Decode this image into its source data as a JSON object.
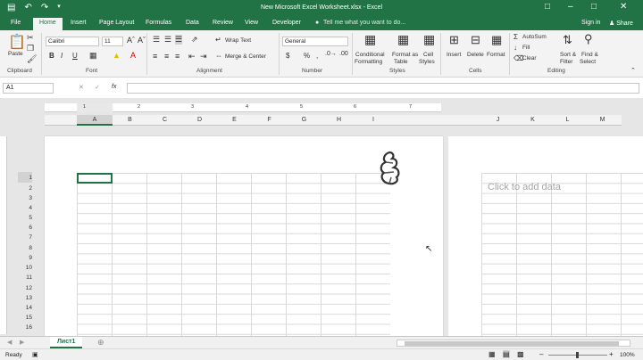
{
  "title_bar": {
    "title": "New Microsoft Excel Worksheet.xlsx - Excel"
  },
  "tabs": [
    {
      "label": "File"
    },
    {
      "label": "Home"
    },
    {
      "label": "Insert"
    },
    {
      "label": "Page Layout"
    },
    {
      "label": "Formulas"
    },
    {
      "label": "Data"
    },
    {
      "label": "Review"
    },
    {
      "label": "View"
    },
    {
      "label": "Developer"
    }
  ],
  "tell_me": "Tell me what you want to do...",
  "sign_in": "Sign in",
  "share": "Share",
  "ribbon": {
    "clipboard": {
      "paste": "Paste",
      "label": "Clipboard"
    },
    "font": {
      "name": "Calibri",
      "size": "11",
      "label": "Font",
      "bold": "B",
      "italic": "I",
      "underline": "U"
    },
    "alignment": {
      "wrap_text": "Wrap Text",
      "merge_center": "Merge & Center",
      "label": "Alignment"
    },
    "number": {
      "format": "General",
      "label": "Number",
      "currency": "$",
      "percent": "%",
      "comma": ","
    },
    "styles": {
      "conditional_1": "Conditional",
      "conditional_2": "Formatting",
      "format_table_1": "Format as",
      "format_table_2": "Table",
      "cell_styles_1": "Cell",
      "cell_styles_2": "Styles",
      "label": "Styles"
    },
    "cells": {
      "insert": "Insert",
      "delete": "Delete",
      "format": "Format",
      "label": "Cells"
    },
    "editing": {
      "autosum": "AutoSum",
      "fill": "Fill",
      "clear": "Clear",
      "sort_1": "Sort &",
      "sort_2": "Filter",
      "find_1": "Find &",
      "find_2": "Select",
      "label": "Editing"
    }
  },
  "formula_bar": {
    "name_box": "A1",
    "fx": "fx",
    "cancel": "✕",
    "enter": "✓"
  },
  "ruler_numbers": [
    "1",
    "2",
    "3",
    "4",
    "5",
    "6",
    "7"
  ],
  "columns": [
    "A",
    "B",
    "C",
    "D",
    "E",
    "F",
    "G",
    "H",
    "I",
    "J",
    "K",
    "L",
    "M"
  ],
  "rows": [
    "1",
    "2",
    "3",
    "4",
    "5",
    "6",
    "7",
    "8",
    "9",
    "10",
    "11",
    "12",
    "13",
    "14",
    "15",
    "16"
  ],
  "click_to_add": "Click to add data",
  "sheet_tab": "Лист1",
  "status": {
    "ready": "Ready",
    "zoom": "100%"
  },
  "colors": {
    "brand": "#217346"
  }
}
